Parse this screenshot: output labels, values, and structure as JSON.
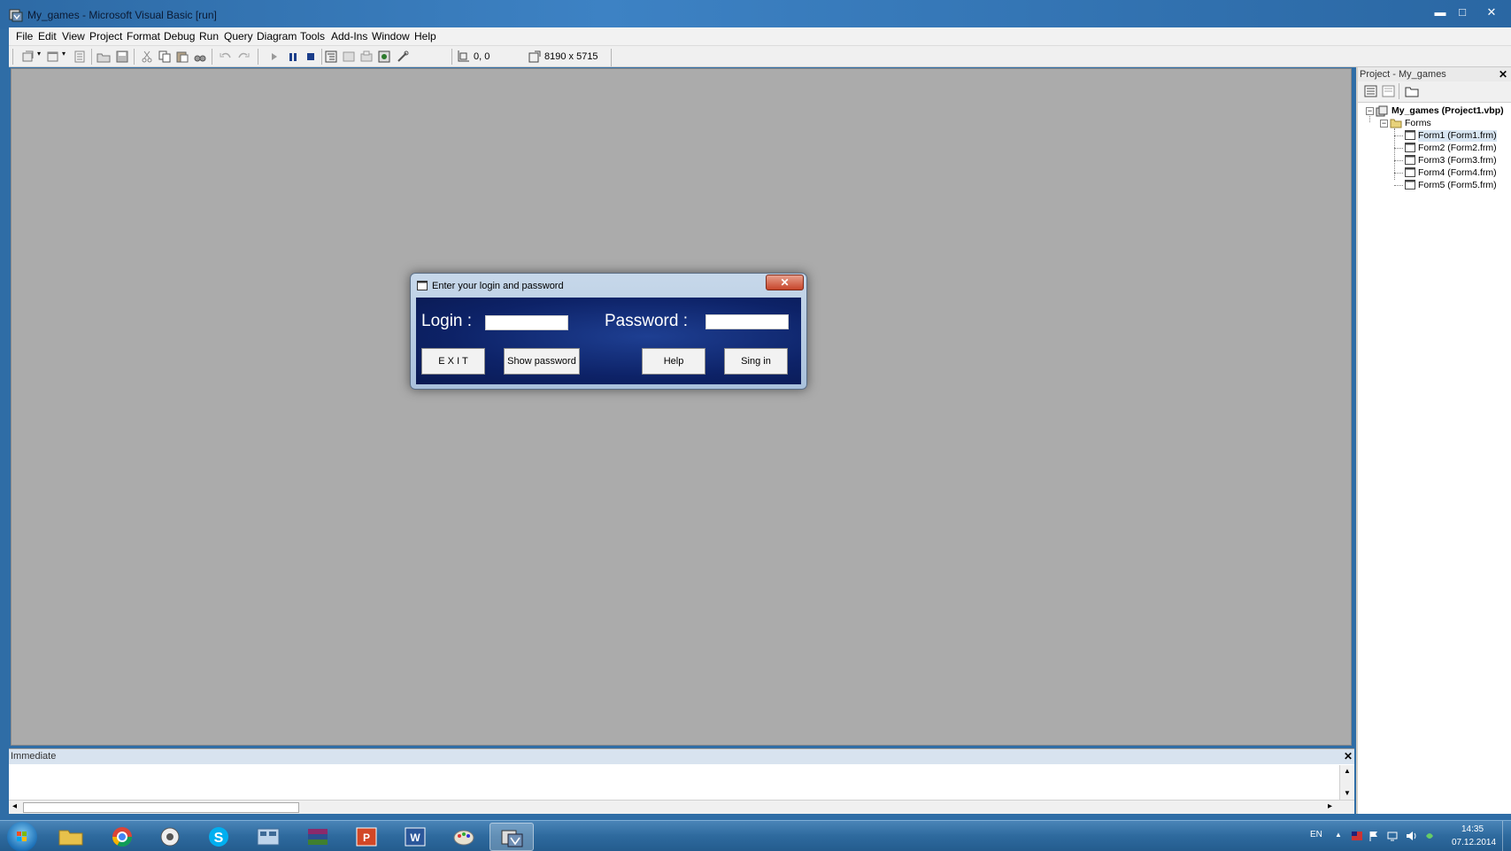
{
  "window": {
    "title": "My_games - Microsoft Visual Basic [run]",
    "minimize_glyph": "▬",
    "maximize_glyph": "□",
    "close_glyph": "✕"
  },
  "menu": {
    "items": [
      "File",
      "Edit",
      "View",
      "Project",
      "Format",
      "Debug",
      "Run",
      "Query",
      "Diagram",
      "Tools",
      "Add-Ins",
      "Window",
      "Help"
    ]
  },
  "toolbar": {
    "position": "0, 0",
    "size": "8190 x 5715"
  },
  "project_explorer": {
    "title": "Project - My_games",
    "close_glyph": "✕",
    "root": "My_games (Project1.vbp)",
    "folder": "Forms",
    "forms": [
      "Form1 (Form1.frm)",
      "Form2 (Form2.frm)",
      "Form3 (Form3.frm)",
      "Form4 (Form4.frm)",
      "Form5 (Form5.frm)"
    ],
    "expander": "−"
  },
  "immediate": {
    "title": "Immediate",
    "close_glyph": "✕",
    "up_arrow": "▲",
    "down_arrow": "▼",
    "left_arrow": "◂",
    "right_arrow": "▸"
  },
  "dialog": {
    "title": "Enter your login and password",
    "close_glyph": "✕",
    "login_label": "Login :",
    "login_value": "",
    "password_label": "Password :",
    "password_value": "",
    "exit_label": "E X I T",
    "show_password_label": "Show password",
    "help_label": "Help",
    "signin_label": "Sing in"
  },
  "taskbar": {
    "apps": [
      "start-button",
      "explorer",
      "chrome",
      "media-player",
      "skype",
      "control-panel",
      "winrar",
      "powerpoint",
      "word",
      "paint",
      "visual-basic"
    ],
    "language": "EN",
    "time": "14:35",
    "date": "07.12.2014",
    "tray_arrow": "▲"
  },
  "colors": {
    "mdi_background": "#ababab",
    "dialog_body": "#0d2267",
    "taskbar": "#2e6a9e"
  }
}
